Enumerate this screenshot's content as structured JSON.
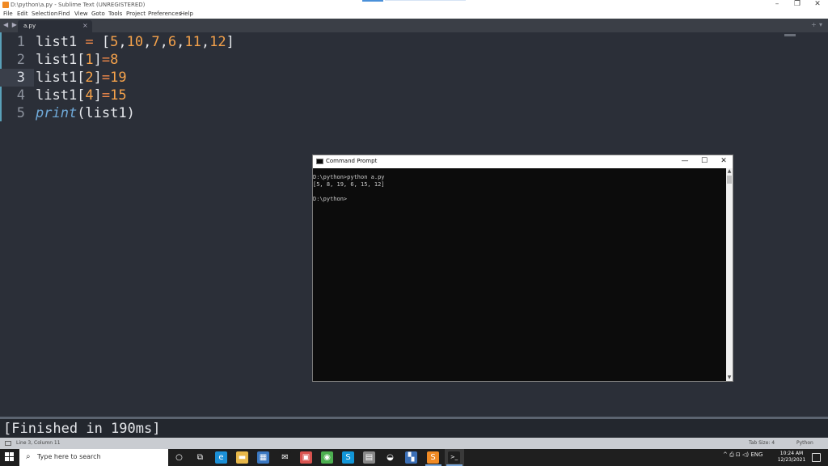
{
  "window": {
    "title": "D:\\python\\a.py - Sublime Text (UNREGISTERED)",
    "controls": {
      "minimize": "–",
      "restore": "❐",
      "close": "✕"
    }
  },
  "menu": [
    "File",
    "Edit",
    "Selection",
    "Find",
    "View",
    "Goto",
    "Tools",
    "Project",
    "Preferences",
    "Help"
  ],
  "tabs": {
    "nav": "◀ ▶",
    "active": {
      "label": "a.py",
      "close": "×"
    },
    "buttons": {
      "new": "+",
      "more": "▾"
    }
  },
  "editor": {
    "active_line": 3,
    "lines": [
      {
        "n": "1",
        "parts": [
          [
            "plain",
            "list1 "
          ],
          [
            "op",
            "="
          ],
          [
            "plain",
            " ["
          ],
          [
            "num",
            "5"
          ],
          [
            "plain",
            ","
          ],
          [
            "num",
            "10"
          ],
          [
            "plain",
            ","
          ],
          [
            "num",
            "7"
          ],
          [
            "plain",
            ","
          ],
          [
            "num",
            "6"
          ],
          [
            "plain",
            ","
          ],
          [
            "num",
            "11"
          ],
          [
            "plain",
            ","
          ],
          [
            "num",
            "12"
          ],
          [
            "plain",
            "]"
          ]
        ]
      },
      {
        "n": "2",
        "parts": [
          [
            "plain",
            "list1["
          ],
          [
            "num",
            "1"
          ],
          [
            "plain",
            "]"
          ],
          [
            "op",
            "="
          ],
          [
            "num",
            "8"
          ]
        ]
      },
      {
        "n": "3",
        "parts": [
          [
            "plain",
            "list1["
          ],
          [
            "num",
            "2"
          ],
          [
            "plain",
            "]"
          ],
          [
            "op",
            "="
          ],
          [
            "num",
            "19"
          ]
        ]
      },
      {
        "n": "4",
        "parts": [
          [
            "plain",
            "list1["
          ],
          [
            "num",
            "4"
          ],
          [
            "plain",
            "]"
          ],
          [
            "op",
            "="
          ],
          [
            "num",
            "15"
          ]
        ]
      },
      {
        "n": "5",
        "parts": [
          [
            "fn",
            "print"
          ],
          [
            "plain",
            "(list1)"
          ]
        ]
      }
    ]
  },
  "output_panel": {
    "text": "[Finished in 190ms]"
  },
  "statusbar": {
    "position": "Line 3, Column 11",
    "tab_size": "Tab Size: 4",
    "syntax": "Python"
  },
  "cmd_window": {
    "title": "Command Prompt",
    "controls": {
      "minimize": "—",
      "maximize": "☐",
      "close": "✕"
    },
    "lines": [
      "D:\\python>python a.py",
      "[5, 8, 19, 6, 15, 12]",
      "",
      "D:\\python>"
    ]
  },
  "taskbar": {
    "search_placeholder": "Type here to search",
    "search_icon": "⌕",
    "icons": [
      {
        "name": "cortana-icon",
        "glyph": "○",
        "color": "#1f1f1f"
      },
      {
        "name": "task-view-icon",
        "glyph": "⧉",
        "color": "#1f1f1f"
      },
      {
        "name": "edge-icon",
        "glyph": "e",
        "color": "#1b8fd6"
      },
      {
        "name": "file-explorer-icon",
        "glyph": "▬",
        "color": "#e8b84a"
      },
      {
        "name": "store-icon",
        "glyph": "▦",
        "color": "#3a78c2"
      },
      {
        "name": "mail-icon",
        "glyph": "✉",
        "color": "#1f1f1f"
      },
      {
        "name": "office-icon",
        "glyph": "▣",
        "color": "#d9534f"
      },
      {
        "name": "chrome-icon",
        "glyph": "◉",
        "color": "#4caf50"
      },
      {
        "name": "skype-icon",
        "glyph": "S",
        "color": "#1296d8"
      },
      {
        "name": "app-icon",
        "glyph": "▤",
        "color": "#888888"
      },
      {
        "name": "browser-icon",
        "glyph": "◒",
        "color": "#1f1f1f"
      },
      {
        "name": "python-icon",
        "glyph": "▚",
        "color": "#3b6fb6"
      },
      {
        "name": "sublime-icon",
        "glyph": "S",
        "color": "#f08a24"
      },
      {
        "name": "cmd-icon",
        "glyph": ">_",
        "color": "#1f1f1f"
      }
    ],
    "tray": "^  ⎙  ⊡  ◁)  ENG",
    "clock_time": "10:24 AM",
    "clock_date": "12/23/2021"
  },
  "colors": {
    "editor_bg": "#2b2f38",
    "number": "#f5a24b",
    "operator": "#f38a4a",
    "function": "#6fa9d8",
    "console_bg": "#0c0c0c"
  }
}
